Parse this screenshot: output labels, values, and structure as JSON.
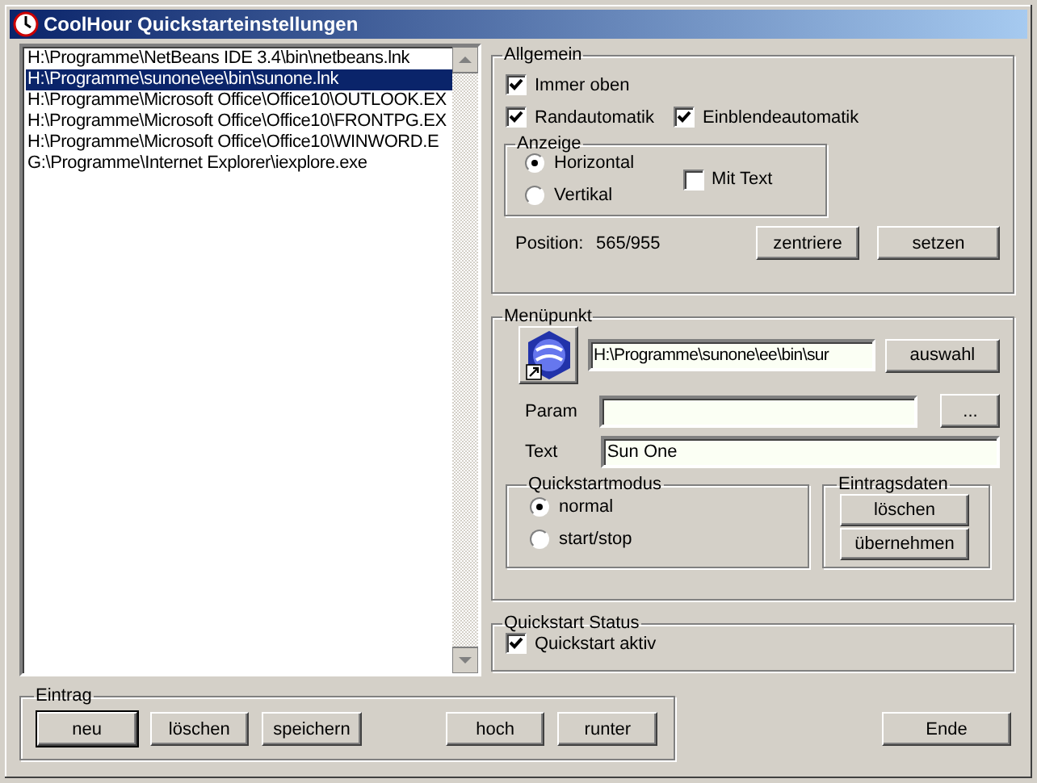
{
  "window": {
    "title": "CoolHour Quickstarteinstellungen"
  },
  "entries": [
    {
      "label": "H:\\Programme\\NetBeans IDE 3.4\\bin\\netbeans.lnk",
      "selected": false
    },
    {
      "label": "H:\\Programme\\sunone\\ee\\bin\\sunone.lnk",
      "selected": true
    },
    {
      "label": "H:\\Programme\\Microsoft Office\\Office10\\OUTLOOK.EX",
      "selected": false
    },
    {
      "label": "H:\\Programme\\Microsoft Office\\Office10\\FRONTPG.EX",
      "selected": false
    },
    {
      "label": "H:\\Programme\\Microsoft Office\\Office10\\WINWORD.E",
      "selected": false
    },
    {
      "label": "G:\\Programme\\Internet Explorer\\iexplore.exe",
      "selected": false
    }
  ],
  "general": {
    "title": "Allgemein",
    "options": [
      {
        "label": "Immer oben",
        "checked": true
      },
      {
        "label": "Randautomatik",
        "checked": true
      },
      {
        "label": "Einblendeautomatik",
        "checked": true
      }
    ],
    "display": {
      "title": "Anzeige",
      "orientation": [
        {
          "label": "Horizontal",
          "selected": true
        },
        {
          "label": "Vertikal",
          "selected": false
        }
      ],
      "with_text": {
        "label": "Mit Text",
        "checked": false
      }
    },
    "position_label": "Position:",
    "position_value": "565/955",
    "buttons": [
      "zentriere",
      "setzen"
    ]
  },
  "menu_item": {
    "title": "Menüpunkt",
    "path": "H:\\Programme\\sunone\\ee\\bin\\sur",
    "browse_button": "auswahl",
    "param_label": "Param",
    "param_button": "...",
    "text_label": "Text",
    "text_value": "Sun One",
    "mode": {
      "title": "Quickstartmodus",
      "options": [
        {
          "label": "normal",
          "selected": true
        },
        {
          "label": "start/stop",
          "selected": false
        }
      ]
    },
    "entry_data": {
      "title": "Eintragsdaten",
      "buttons": [
        "löschen",
        "übernehmen"
      ]
    }
  },
  "status": {
    "title": "Quickstart Status",
    "active": {
      "label": "Quickstart aktiv",
      "checked": true
    }
  },
  "entry": {
    "title": "Eintrag",
    "buttons": [
      {
        "label": "neu",
        "default": true
      },
      {
        "label": "löschen",
        "default": false
      },
      {
        "label": "speichern",
        "default": false
      },
      {
        "label": "hoch",
        "default": false
      },
      {
        "label": "runter",
        "default": false
      }
    ]
  },
  "exit_button": "Ende"
}
